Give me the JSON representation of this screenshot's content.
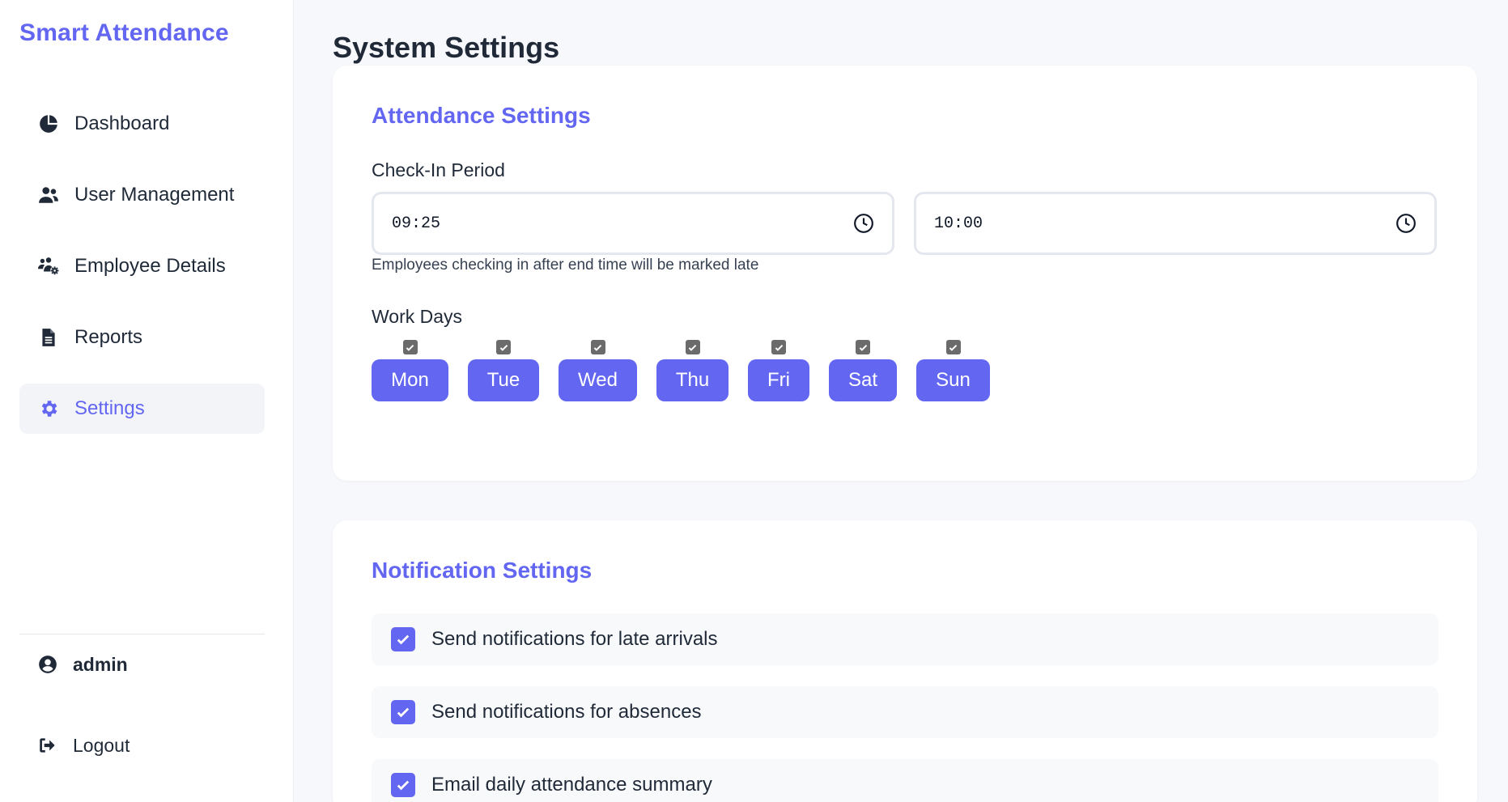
{
  "brand": "Smart Attendance",
  "sidebar": {
    "items": [
      {
        "label": "Dashboard",
        "icon": "pie-chart-icon"
      },
      {
        "label": "User Management",
        "icon": "users-icon"
      },
      {
        "label": "Employee Details",
        "icon": "users-cog-icon"
      },
      {
        "label": "Reports",
        "icon": "file-icon"
      },
      {
        "label": "Settings",
        "icon": "gear-icon",
        "active": true
      }
    ],
    "user": "admin",
    "logout": "Logout"
  },
  "page": {
    "title": "System Settings"
  },
  "attendance": {
    "title": "Attendance Settings",
    "checkin_label": "Check-In Period",
    "start_time": "09:25",
    "end_time": "10:00",
    "hint": "Employees checking in after end time will be marked late",
    "workdays_label": "Work Days",
    "days": [
      {
        "label": "Mon",
        "checked": true
      },
      {
        "label": "Tue",
        "checked": true
      },
      {
        "label": "Wed",
        "checked": true
      },
      {
        "label": "Thu",
        "checked": true
      },
      {
        "label": "Fri",
        "checked": true
      },
      {
        "label": "Sat",
        "checked": true
      },
      {
        "label": "Sun",
        "checked": true
      }
    ]
  },
  "notifications": {
    "title": "Notification Settings",
    "options": [
      {
        "label": "Send notifications for late arrivals",
        "checked": true
      },
      {
        "label": "Send notifications for absences",
        "checked": true
      },
      {
        "label": "Email daily attendance summary",
        "checked": true
      }
    ]
  },
  "colors": {
    "accent": "#6366f1",
    "background": "#f7f8fb",
    "card": "#ffffff"
  }
}
